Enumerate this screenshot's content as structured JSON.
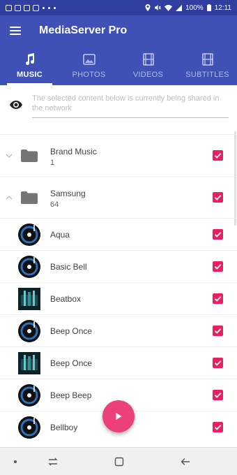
{
  "status_bar": {
    "battery": "100%",
    "time": "12:11"
  },
  "app": {
    "title": "MediaServer Pro"
  },
  "tabs": [
    {
      "label": "MUSIC",
      "icon": "music-note-icon",
      "active": true
    },
    {
      "label": "PHOTOS",
      "icon": "photo-icon",
      "active": false
    },
    {
      "label": "VIDEOS",
      "icon": "film-icon",
      "active": false
    },
    {
      "label": "SUBTITLES",
      "icon": "subtitle-film-icon",
      "active": false
    }
  ],
  "info": {
    "placeholder": "The selected content below is currently being shared in the network"
  },
  "folders": [
    {
      "name": "Brand Music",
      "count": "1",
      "expanded": false,
      "checked": true
    },
    {
      "name": "Samsung",
      "count": "64",
      "expanded": true,
      "checked": true
    }
  ],
  "tracks": [
    {
      "name": "Aqua",
      "thumb": "disc",
      "checked": true
    },
    {
      "name": "Basic Bell",
      "thumb": "disc",
      "checked": true
    },
    {
      "name": "Beatbox",
      "thumb": "art",
      "checked": true
    },
    {
      "name": "Beep Once",
      "thumb": "disc",
      "checked": true
    },
    {
      "name": "Beep Once",
      "thumb": "art",
      "checked": true
    },
    {
      "name": "Beep Beep",
      "thumb": "disc",
      "checked": true
    },
    {
      "name": "Bellboy",
      "thumb": "disc",
      "checked": true
    }
  ],
  "colors": {
    "primary": "#3f51b5",
    "primary_dark": "#303f9f",
    "accent": "#e91e63"
  }
}
